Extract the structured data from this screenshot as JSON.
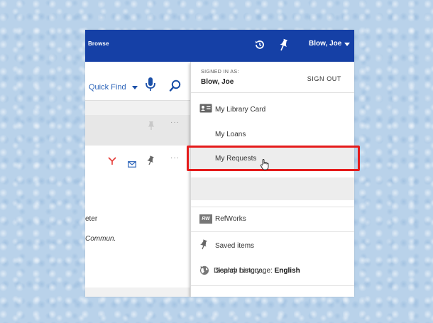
{
  "topbar": {
    "browse_label": "Browse",
    "history_icon": "history-icon",
    "pin_icon": "pin-icon",
    "user_name": "Blow, Joe"
  },
  "search": {
    "scope_label": "Quick Find",
    "mic_icon": "microphone-icon",
    "search_icon": "search-icon"
  },
  "results": {
    "fragment_1": "eter",
    "fragment_2": "Commun.",
    "action_more": "···"
  },
  "account_menu": {
    "signed_in_label": "SIGNED IN AS:",
    "signed_in_name": "Blow, Joe",
    "sign_out_label": "SIGN OUT",
    "items": [
      {
        "label": "My Library Card",
        "icon": "library-card-icon"
      },
      {
        "label": "My Loans",
        "icon": ""
      },
      {
        "label": "My Requests",
        "icon": ""
      },
      {
        "label": "RefWorks",
        "icon": "refworks-icon",
        "badge": "RW"
      },
      {
        "label": "Saved items",
        "icon": "pin-icon"
      },
      {
        "label": "Search history",
        "icon": "history-icon"
      }
    ],
    "language_label": "Display Language: ",
    "language_value": "English"
  },
  "colors": {
    "header_blue": "#1540a6",
    "highlight_red": "#e51b1b",
    "link_blue": "#2a62b8"
  }
}
